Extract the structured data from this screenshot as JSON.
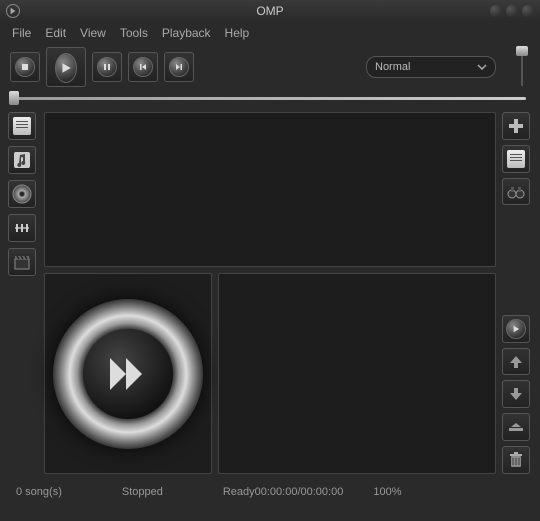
{
  "title": "OMP",
  "menu": {
    "file": "File",
    "edit": "Edit",
    "view": "View",
    "tools": "Tools",
    "playback": "Playback",
    "help": "Help"
  },
  "mode": {
    "selected": "Normal"
  },
  "status": {
    "songs": "0 song(s)",
    "state": "Stopped",
    "ready": "Ready",
    "time": "00:00:00/00:00:00",
    "percent": "100%"
  }
}
